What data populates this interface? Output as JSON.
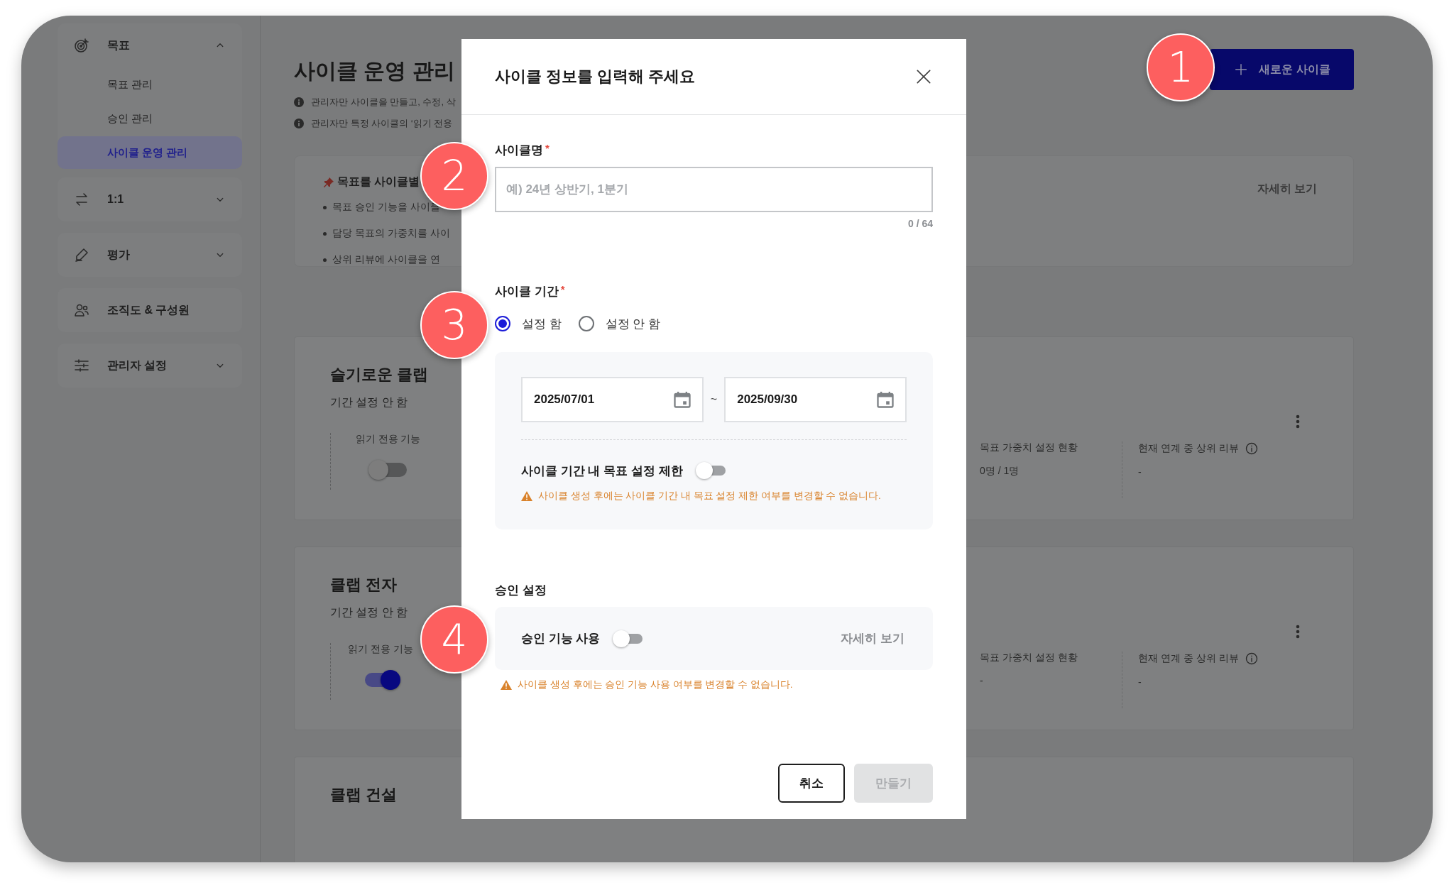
{
  "sidebar": {
    "groups": [
      {
        "label": "목표",
        "kind": "group",
        "expanded": true,
        "children": [
          {
            "label": "목표 관리",
            "selected": false
          },
          {
            "label": "승인 관리",
            "selected": false
          },
          {
            "label": "사이클 운영 관리",
            "selected": true
          }
        ]
      },
      {
        "label": "1:1",
        "kind": "group",
        "expanded": false
      },
      {
        "label": "평가",
        "kind": "group",
        "expanded": false
      },
      {
        "label": "조직도 & 구성원",
        "kind": "link"
      },
      {
        "label": "관리자 설정",
        "kind": "group",
        "expanded": false
      }
    ]
  },
  "page": {
    "title": "사이클 운영 관리",
    "notes": [
      "관리자만 사이클을 만들고, 수정, 삭",
      "관리자만 특정 사이클의 ‘읽기 전용"
    ],
    "new_button": "새로운 사이클"
  },
  "guide_card": {
    "title": "목표를 사이클별",
    "bullets": [
      "목표 승인 기능을 사이클",
      "담당 목표의 가중치를 사이",
      "상위 리뷰에 사이클을 연"
    ],
    "link": "자세히 보기"
  },
  "cycles": [
    {
      "name": "슬기로운 클랩",
      "period": "기간 설정 안 함",
      "read_only_label": "읽기 전용 기능",
      "read_only_on": false,
      "weight_label": "목표 가중치 설정 현황",
      "weight_value": "0명 / 1명",
      "review_label": "현재 연계 중 상위 리뷰",
      "review_value": "-"
    },
    {
      "name": "클랩 전자",
      "period": "기간 설정 안 함",
      "read_only_label": "읽기 전용 기능",
      "read_only_on": true,
      "weight_label": "목표 가중치 설정 현황",
      "weight_value": "-",
      "review_label": "현재 연계 중 상위 리뷰",
      "review_value": "-"
    },
    {
      "name": "클랩 건설"
    }
  ],
  "modal": {
    "title": "사이클 정보를 입력해 주세요",
    "name_field": {
      "label": "사이클명",
      "required_mark": "*",
      "placeholder": "예) 24년 상반기, 1분기",
      "counter": "0 / 64"
    },
    "period": {
      "label": "사이클 기간",
      "required_mark": "*",
      "options": [
        {
          "label": "설정 함",
          "selected": true
        },
        {
          "label": "설정 안 함",
          "selected": false
        }
      ],
      "start_date": "2025/07/01",
      "separator": "~",
      "end_date": "2025/09/30",
      "restrict_label": "사이클 기간 내 목표 설정 제한",
      "restrict_on": false,
      "warning": "사이클 생성 후에는 사이클 기간 내 목표 설정 제한 여부를 변경할 수 없습니다."
    },
    "approval": {
      "label": "승인 설정",
      "toggle_label": "승인 기능 사용",
      "toggle_on": false,
      "link": "자세히 보기",
      "warning": "사이클 생성 후에는 승인 기능 사용 여부를 변경할 수 없습니다."
    },
    "buttons": [
      {
        "label": "취소",
        "disabled": false
      },
      {
        "label": "만들기",
        "disabled": true
      }
    ]
  },
  "callouts": [
    "1",
    "2",
    "3",
    "4"
  ]
}
